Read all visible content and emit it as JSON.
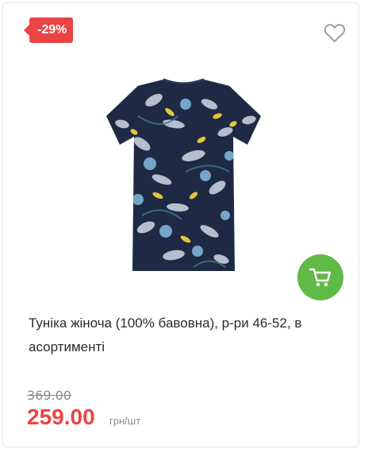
{
  "product": {
    "discount_badge": "-29%",
    "title": "Туніка жіноча (100% бавовна), р-ри 46-52, в асортименті",
    "old_price": "369.00",
    "new_price": "259.00",
    "price_unit": "грн/шт"
  },
  "icons": {
    "favorite": "heart-outline-icon",
    "cart": "shopping-cart-icon"
  },
  "colors": {
    "badge": "#ea4444",
    "price": "#ea4444",
    "cart_button": "#5fba46",
    "tunic_base": "#1e2a44"
  }
}
